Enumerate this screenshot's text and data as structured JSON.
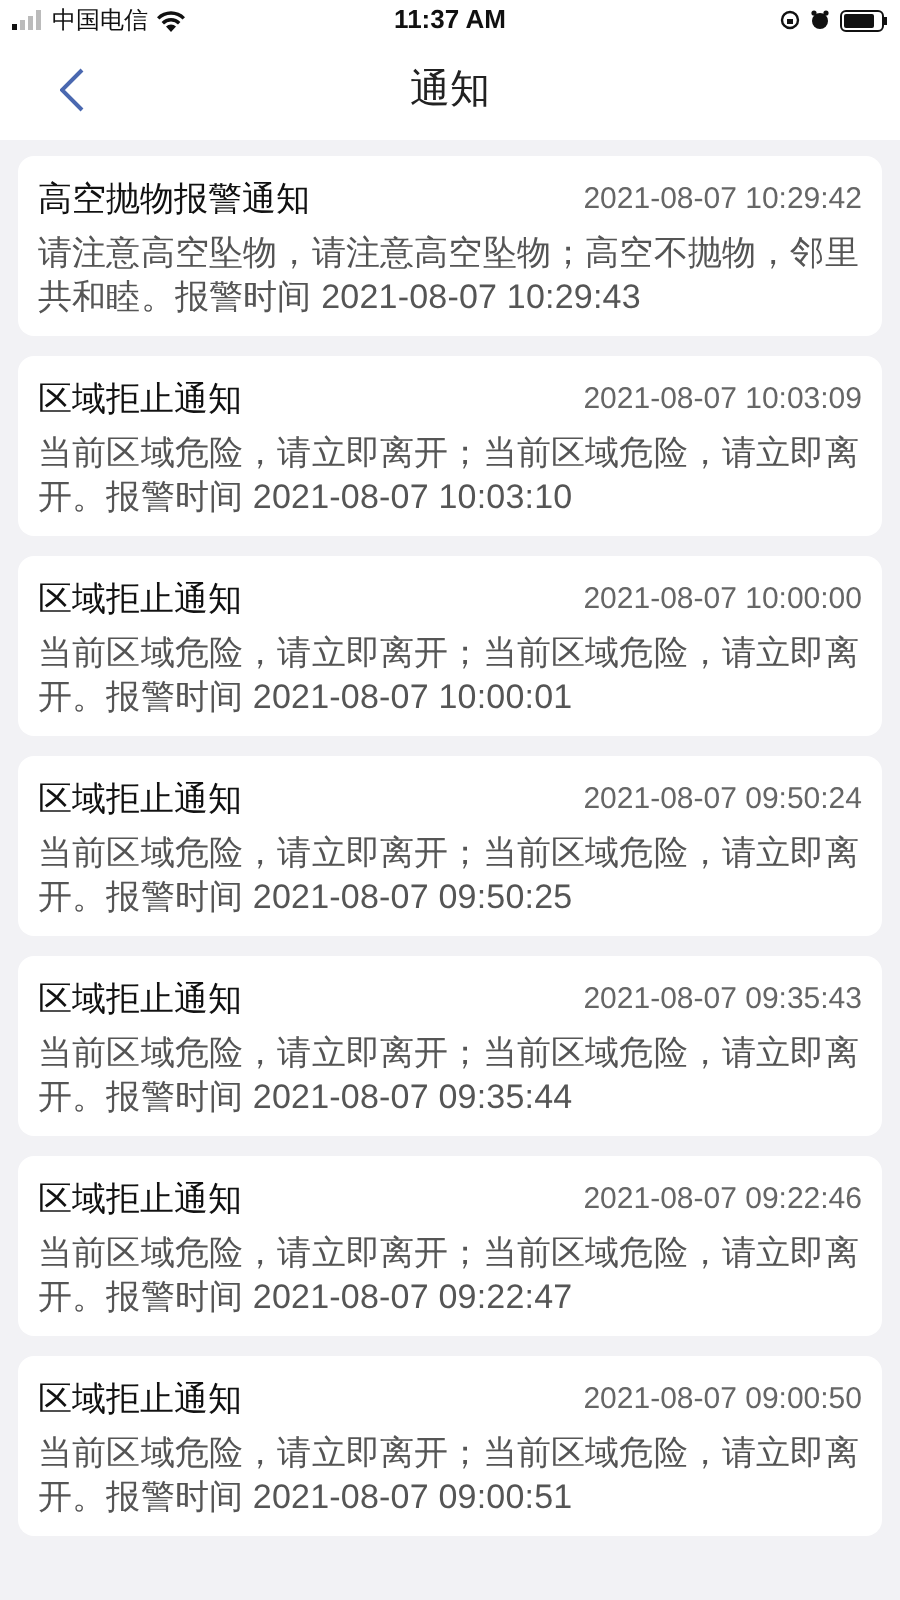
{
  "status_bar": {
    "carrier": "中国电信",
    "time": "11:37 AM"
  },
  "nav": {
    "title": "通知"
  },
  "notifications": [
    {
      "title": "高空抛物报警通知",
      "time": "2021-08-07 10:29:42",
      "body": "请注意高空坠物，请注意高空坠物；高空不抛物，邻里共和睦。报警时间 2021-08-07 10:29:43"
    },
    {
      "title": "区域拒止通知",
      "time": "2021-08-07 10:03:09",
      "body": "当前区域危险，请立即离开；当前区域危险，请立即离开。报警时间 2021-08-07 10:03:10"
    },
    {
      "title": "区域拒止通知",
      "time": "2021-08-07 10:00:00",
      "body": "当前区域危险，请立即离开；当前区域危险，请立即离开。报警时间 2021-08-07 10:00:01"
    },
    {
      "title": "区域拒止通知",
      "time": "2021-08-07 09:50:24",
      "body": "当前区域危险，请立即离开；当前区域危险，请立即离开。报警时间 2021-08-07 09:50:25"
    },
    {
      "title": "区域拒止通知",
      "time": "2021-08-07 09:35:43",
      "body": "当前区域危险，请立即离开；当前区域危险，请立即离开。报警时间 2021-08-07 09:35:44"
    },
    {
      "title": "区域拒止通知",
      "time": "2021-08-07 09:22:46",
      "body": "当前区域危险，请立即离开；当前区域危险，请立即离开。报警时间 2021-08-07 09:22:47"
    },
    {
      "title": "区域拒止通知",
      "time": "2021-08-07 09:00:50",
      "body": "当前区域危险，请立即离开；当前区域危险，请立即离开。报警时间 2021-08-07 09:00:51"
    }
  ]
}
